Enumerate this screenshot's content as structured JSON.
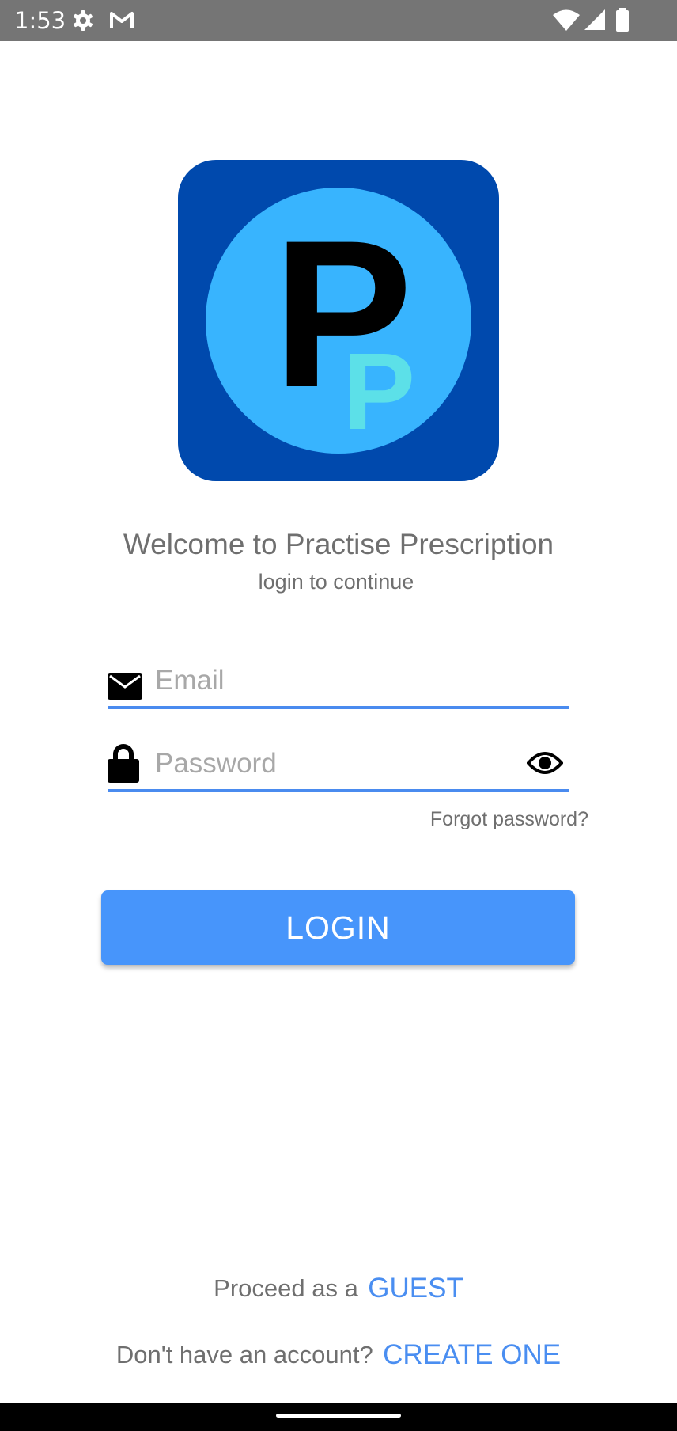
{
  "status_bar": {
    "time": "1:53",
    "icons": [
      "gear-icon",
      "gmail-icon",
      "wifi-icon",
      "cell-signal-icon",
      "battery-icon"
    ]
  },
  "app": {
    "logo_big_letter": "P",
    "logo_small_letter": "P",
    "colors": {
      "logo_square": "#0049ad",
      "logo_circle": "#38b4fe",
      "logo_small_letter": "#5ce0e8",
      "accent": "#4795fb",
      "underline": "#4a8bef",
      "link": "#4a8ef1"
    }
  },
  "welcome": {
    "title": "Welcome to Practise Prescription",
    "subtitle": "login to continue"
  },
  "form": {
    "email": {
      "placeholder": "Email",
      "value": "",
      "icon": "envelope-icon"
    },
    "password": {
      "placeholder": "Password",
      "value": "",
      "icon": "lock-icon",
      "toggle_icon": "eye-icon"
    },
    "forgot_password": "Forgot password?",
    "login_label": "LOGIN"
  },
  "footer": {
    "guest_prompt": "Proceed as a",
    "guest_link": "GUEST",
    "signup_prompt": "Don't have an account?",
    "signup_link": "CREATE ONE"
  }
}
